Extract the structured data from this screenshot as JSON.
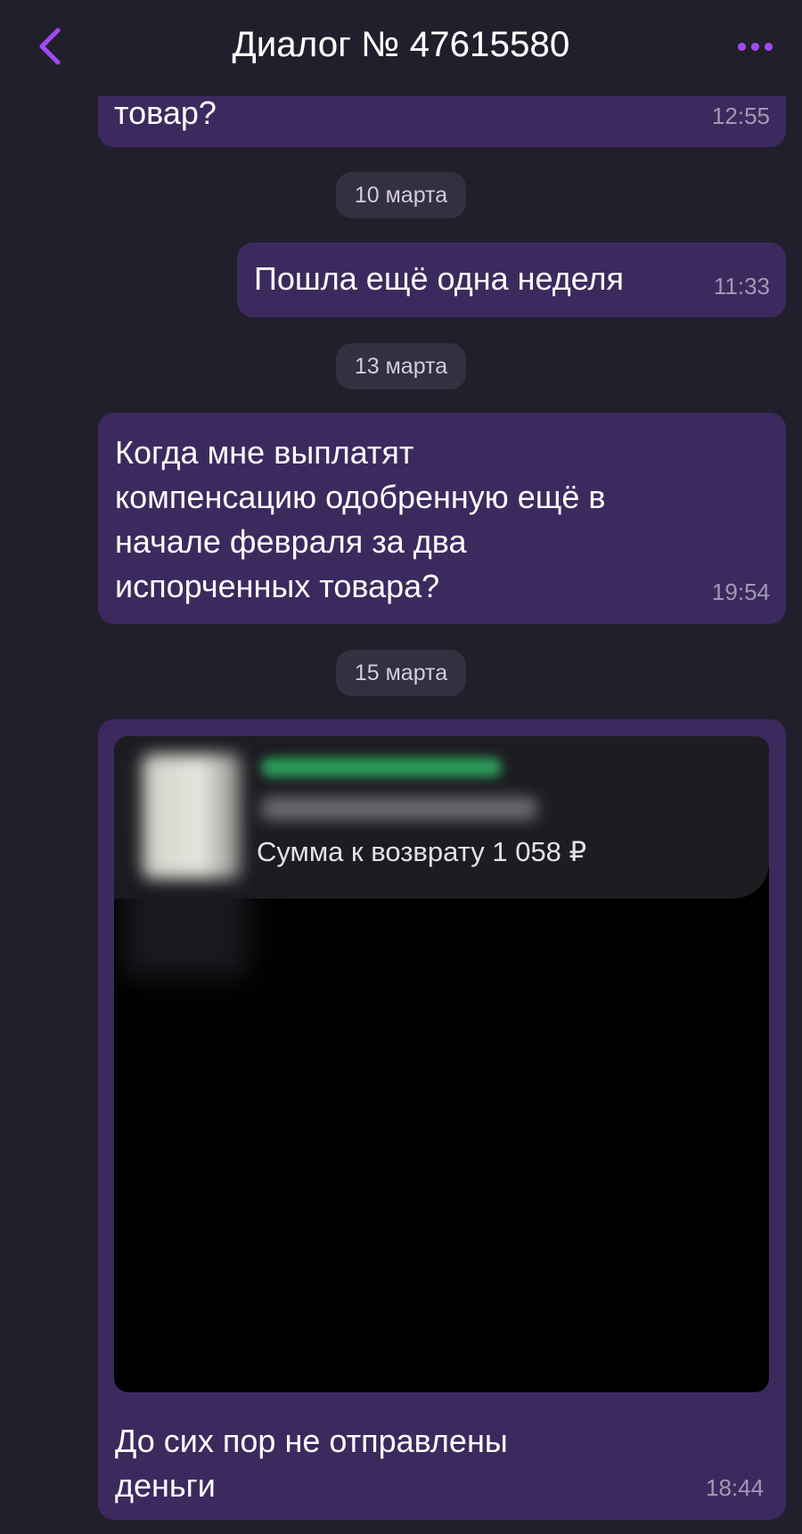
{
  "header": {
    "title": "Диалог № 47615580",
    "back_icon": "chevron-left-icon",
    "more_icon": "more-dots-icon",
    "accent": "#a149f0"
  },
  "messages": [
    {
      "text": "товар?",
      "time": "12:55"
    },
    {
      "date": "10 марта"
    },
    {
      "text": "Пошла ещё одна неделя",
      "time": "11:33"
    },
    {
      "date": "13 марта"
    },
    {
      "lines": [
        "Когда мне выплатят",
        "компенсацию одобренную ещё в",
        "начале февраля за два",
        "испорченных товара?"
      ],
      "time": "19:54"
    },
    {
      "date": "15 марта"
    },
    {
      "attachment": {
        "refund_text": "Сумма к возврату 1 058 ₽"
      },
      "lines": [
        "До сих пор не отправлены",
        "деньги"
      ],
      "time": "18:44"
    }
  ],
  "colors": {
    "background": "#221f2c",
    "bubble": "#3c2a5e",
    "date_pill": "#34303f",
    "time_text": "#a298b5"
  }
}
